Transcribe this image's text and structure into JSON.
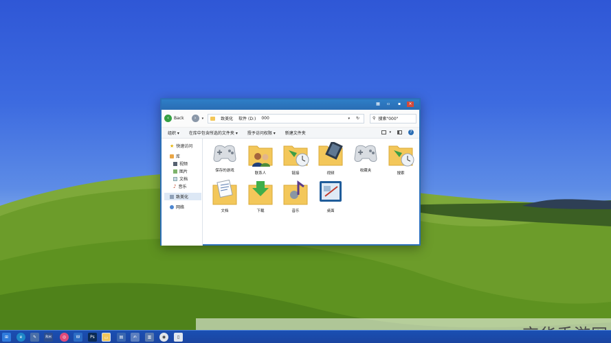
{
  "window": {
    "back_label": "Back",
    "breadcrumb": [
      "致美化",
      "软件 (D:)",
      "000"
    ],
    "search_placeholder": "搜索\"000\"",
    "toolbar": {
      "organize": "组织 ▾",
      "include_library": "在库中包含所选的文件夹 ▾",
      "share": "授予访问权限 ▾",
      "new_folder": "新建文件夹"
    },
    "sidebar": {
      "quick_access": "快速访问",
      "library": "库",
      "videos": "视频",
      "pictures": "图片",
      "documents": "文档",
      "music": "音乐",
      "zhimeihua": "致美化",
      "network": "网络"
    },
    "items": [
      {
        "label": "保存的游戏",
        "icon": "gamepad-icon"
      },
      {
        "label": "联系人",
        "icon": "contacts-folder-icon"
      },
      {
        "label": "链接",
        "icon": "links-folder-icon"
      },
      {
        "label": "视频",
        "icon": "video-folder-icon"
      },
      {
        "label": "收藏夹",
        "icon": "favorites-gamepad-icon"
      },
      {
        "label": "搜索",
        "icon": "search-folder-icon"
      },
      {
        "label": "文档",
        "icon": "documents-folder-icon"
      },
      {
        "label": "下载",
        "icon": "downloads-folder-icon"
      },
      {
        "label": "音乐",
        "icon": "music-folder-icon"
      },
      {
        "label": "桌面",
        "icon": "desktop-icon"
      }
    ]
  },
  "taskbar": {
    "icons": [
      "start-icon",
      "edge-icon",
      "tool-icon",
      "rh-icon",
      "app-icon",
      "word-icon",
      "photoshop-icon",
      "explorer-icon",
      "notes-icon",
      "notepad-icon",
      "doc-icon",
      "chrome-icon",
      "paper-icon"
    ]
  },
  "watermark": {
    "text": "京华手游网"
  },
  "colors": {
    "titlebar": "#2a6db4",
    "taskbar": "#1b45a0",
    "folder": "#f3c75a"
  }
}
